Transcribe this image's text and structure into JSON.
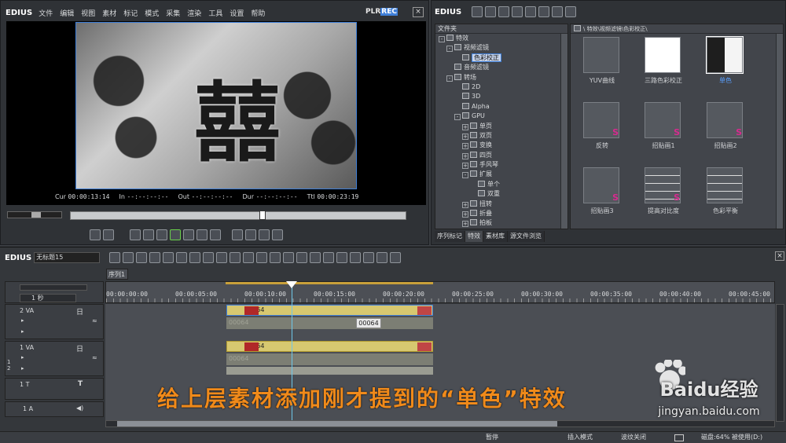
{
  "player": {
    "logo": "EDIUS",
    "menu": [
      "文件",
      "编辑",
      "视图",
      "素材",
      "标记",
      "模式",
      "采集",
      "渲染",
      "工具",
      "设置",
      "帮助"
    ],
    "mode_plr": "PLR",
    "mode_rec": "REC",
    "timecodes": [
      {
        "label": "Cur",
        "value": "00:00:13:14"
      },
      {
        "label": "In",
        "value": "--:--:--:--"
      },
      {
        "label": "Out",
        "value": "--:--:--:--"
      },
      {
        "label": "Dur",
        "value": "--:--:--:--"
      },
      {
        "label": "Ttl",
        "value": "00:00:23:19"
      }
    ],
    "preview_text": "囍"
  },
  "effects": {
    "logo": "EDIUS",
    "tree_header": "文件夹",
    "path": "\\ 特效\\视频滤镜\\色彩校正\\",
    "tree": [
      "特效",
      "视频滤镜",
      "色彩校正",
      "音频滤镜",
      "转场",
      "2D",
      "3D",
      "Alpha",
      "GPU",
      "单页",
      "双页",
      "变换",
      "四页",
      "手风琴",
      "扩展",
      "单个",
      "双重",
      "扭转",
      "折叠",
      "拍板"
    ],
    "tiles": [
      "YUV曲线",
      "三路色彩校正",
      "单色",
      "反转",
      "招贴画1",
      "招贴画2",
      "招贴画3",
      "提高对比度",
      "色彩平衡"
    ],
    "tabs": [
      "序列标记",
      "特效",
      "素材库",
      "源文件浏览"
    ]
  },
  "timeline": {
    "logo": "EDIUS",
    "project_name": "无标题15",
    "sequence_tab": "序列1",
    "scale": "1 秒",
    "ruler": [
      "00:00:00:00",
      "00:00:05:00",
      "00:00:10:00",
      "00:00:15:00",
      "00:00:20:00",
      "00:00:25:00",
      "00:00:30:00",
      "00:00:35:00",
      "00:00:40:00",
      "00:00:45:00"
    ],
    "tracks": [
      {
        "name": "2 VA"
      },
      {
        "name": "1 VA"
      },
      {
        "name": "1 T"
      },
      {
        "name": "1 A"
      }
    ],
    "clip_name": "00064",
    "tooltip": "00064",
    "ghost_name": "00064",
    "side_label_a": "A",
    "side_label_12": "1\n2",
    "t_glyph": "T",
    "v_glyph": "日"
  },
  "caption": "给上层素材添加刚才提到的“单色”特效",
  "watermark": {
    "brand": "Baidu经验",
    "url": "jingyan.baidu.com"
  },
  "status": {
    "pause": "暂停",
    "insert": "插入模式",
    "ripple": "波纹关闭",
    "disk": "磁盘:64% 被使用(D:)"
  },
  "colors": {
    "accent": "#3f7fd8",
    "clip": "#d7c870",
    "caption": "#f08a1a",
    "marker": "#c9a03a"
  }
}
